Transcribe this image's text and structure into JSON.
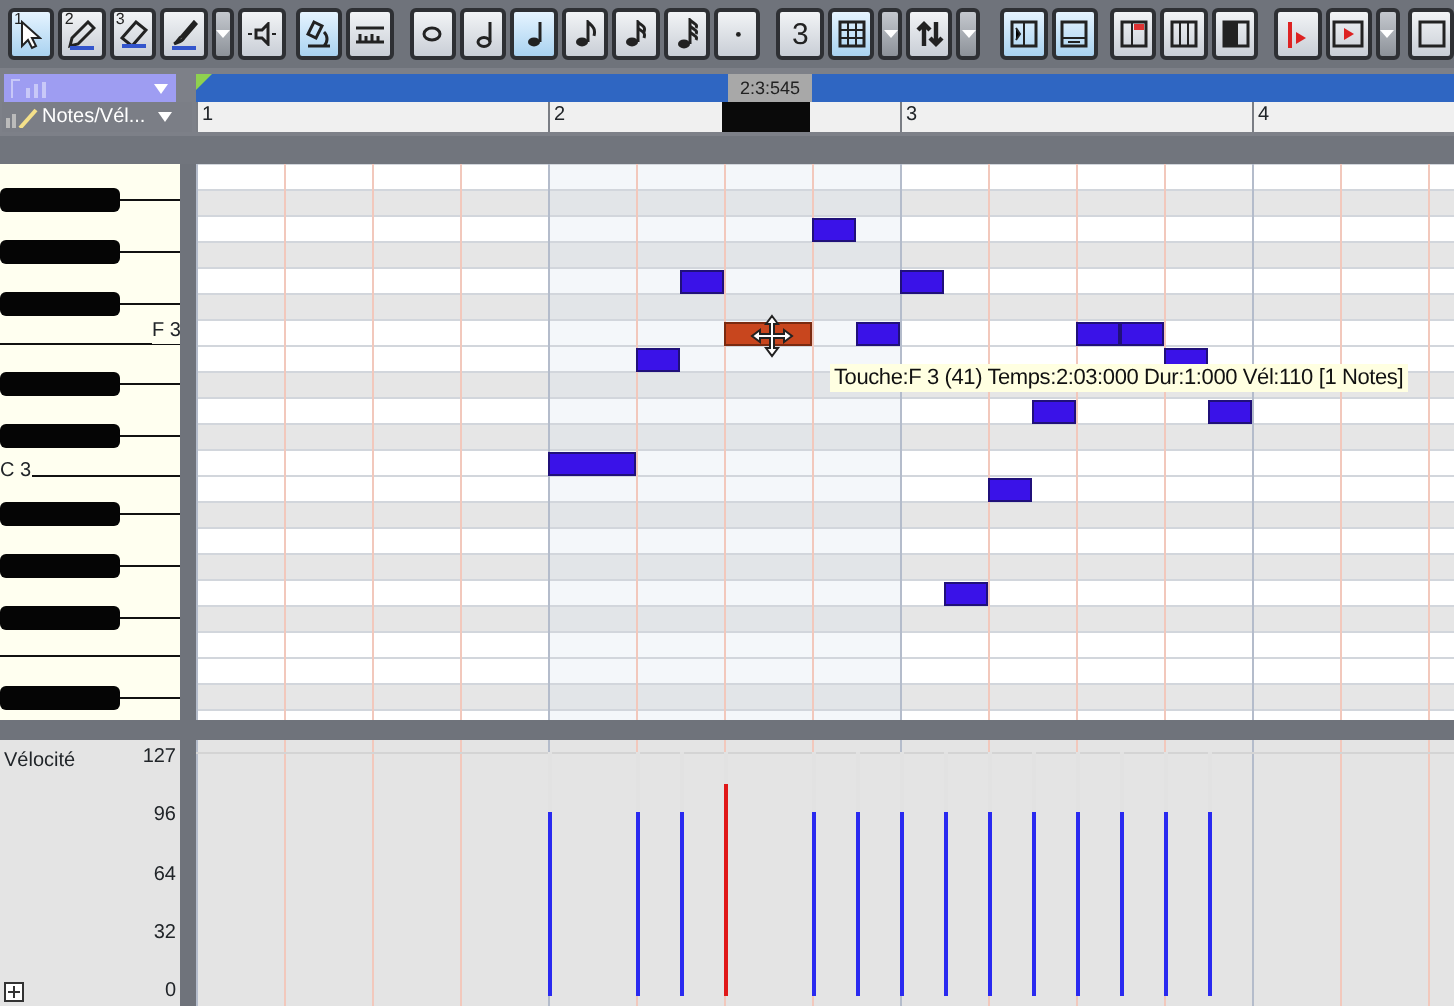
{
  "toolbar": {
    "buttons": [
      {
        "number": "1",
        "selected": true
      },
      {
        "number": "2",
        "selected": false
      },
      {
        "number": "3",
        "selected": false
      },
      {
        "selected": false,
        "dropdown": true
      },
      {
        "selected": false
      },
      {
        "selected": true
      },
      {
        "selected": false
      },
      {
        "selected": false
      },
      {
        "selected": false
      },
      {
        "selected": true
      },
      {
        "selected": false
      },
      {
        "selected": false
      },
      {
        "selected": false
      },
      {
        "selected": false
      },
      {
        "label": "3",
        "selected": false
      },
      {
        "selected": true,
        "dropdown": true
      },
      {
        "selected": false,
        "dropdown": true
      },
      {
        "selected": true
      },
      {
        "selected": true
      },
      {
        "selected": false
      },
      {
        "selected": false
      },
      {
        "selected": false
      },
      {
        "selected": false
      },
      {
        "selected": false,
        "dropdown": true
      },
      {
        "selected": false
      }
    ]
  },
  "lane_panel": {
    "lane_dropdown": {
      "label": "Notes/Vél..."
    }
  },
  "ruler": {
    "position_label": "2:3:545",
    "bars": [
      "1",
      "2",
      "3",
      "4"
    ]
  },
  "keyboard": {
    "key_labels": [
      "F 3",
      "C 3"
    ]
  },
  "notes": [
    {
      "selected": false,
      "level": 0.756
    },
    {
      "selected": false,
      "level": 0.756
    },
    {
      "selected": false,
      "level": 0.756
    },
    {
      "selected": true,
      "level": 0.866
    },
    {
      "selected": false,
      "level": 0.756
    },
    {
      "selected": false,
      "level": 0.756
    },
    {
      "selected": false,
      "level": 0.756
    },
    {
      "selected": false,
      "level": 0.756
    },
    {
      "selected": false,
      "level": 0.756
    },
    {
      "selected": false,
      "level": 0.756
    },
    {
      "selected": false,
      "level": 0.756
    },
    {
      "selected": false,
      "level": 0.756
    },
    {
      "selected": false,
      "level": 0.756
    },
    {
      "selected": false,
      "level": 0.756
    }
  ],
  "tooltip": "Touche:F 3 (41) Temps:2:03:000 Dur:1:000 Vél:110 [1 Notes]",
  "velocity_lane": {
    "label": "Vélocité",
    "ticks": [
      "127",
      "96",
      "64",
      "32",
      "0"
    ]
  }
}
